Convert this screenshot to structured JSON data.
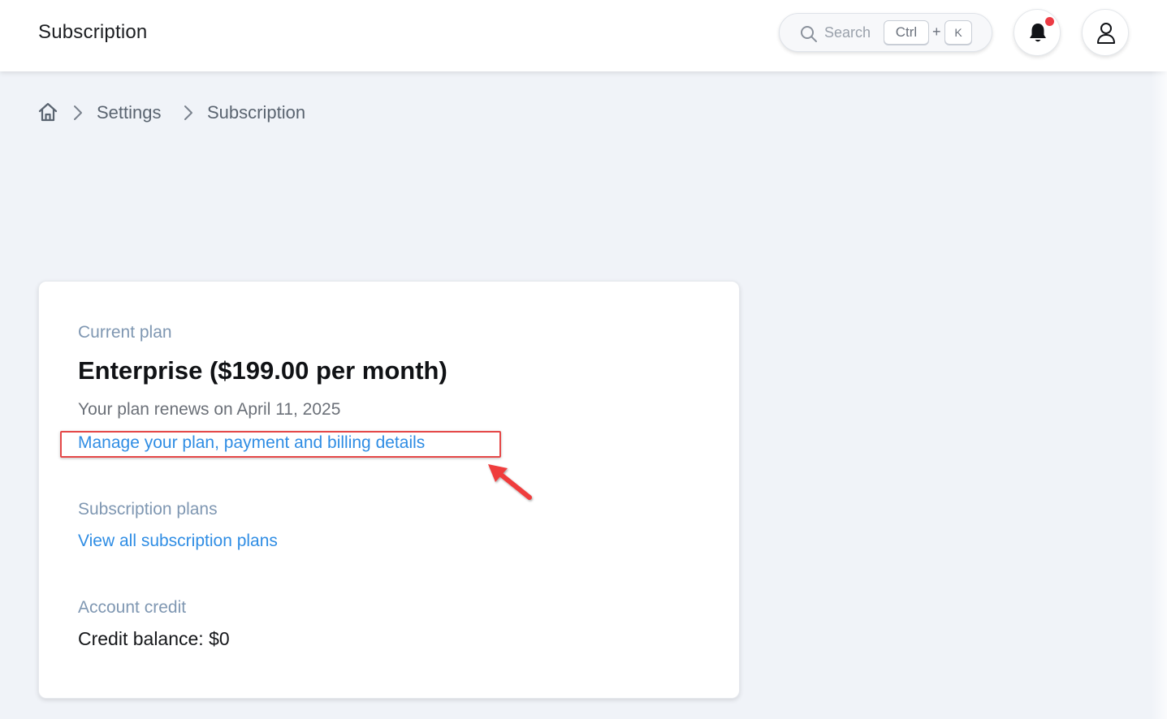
{
  "header": {
    "title": "Subscription",
    "search": {
      "placeholder": "Search",
      "shortcut_key1": "Ctrl",
      "shortcut_plus": "+",
      "shortcut_key2": "K"
    },
    "notification_icon": "bell-icon",
    "notification_badge_color": "#ec3b44",
    "account_icon": "user-icon"
  },
  "breadcrumb": {
    "home_icon": "home-icon",
    "items": [
      "Settings",
      "Subscription"
    ]
  },
  "card": {
    "current_plan_label": "Current plan",
    "plan_name": "Enterprise ($199.00 per month)",
    "renew_text": "Your plan renews on April 11, 2025",
    "manage_link": "Manage your plan, payment and billing details",
    "subscription_plans_label": "Subscription plans",
    "view_plans_link": "View all subscription plans",
    "account_credit_label": "Account credit",
    "credit_balance": "Credit balance: $0"
  },
  "annotation": {
    "highlight_color": "#e54848",
    "arrow_icon": "arrow-pointer-icon"
  },
  "colors": {
    "link": "#2f8de4",
    "section_label": "#7f97b2",
    "page_background": "#f0f3f8"
  }
}
